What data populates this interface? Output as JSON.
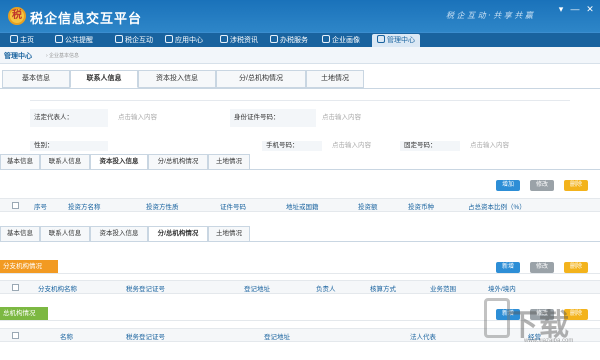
{
  "app": {
    "title": "税企信息交互平台",
    "logo_char": "税",
    "slogan": "税 企 互 动 · 共 享 共 赢",
    "window_controls": [
      "▾",
      "—",
      "✕"
    ]
  },
  "nav": {
    "items": [
      {
        "label": "主页",
        "icon": "home-icon"
      },
      {
        "label": "公共提醒",
        "icon": "bell-icon"
      },
      {
        "label": "税企互动",
        "icon": "chat-icon"
      },
      {
        "label": "应用中心",
        "icon": "apps-icon"
      },
      {
        "label": "涉税资讯",
        "icon": "news-icon"
      },
      {
        "label": "办税服务",
        "icon": "service-icon"
      },
      {
        "label": "企业画像",
        "icon": "portrait-icon"
      },
      {
        "label": "管理中心",
        "icon": "manage-icon"
      }
    ],
    "active_index": 7
  },
  "breadcrumb": {
    "main": "管理中心",
    "sub": "› 企业基本信息"
  },
  "tabs_top": [
    "基本信息",
    "联系人信息",
    "资本投入信息",
    "分/总机构情况",
    "土地情况"
  ],
  "form": {
    "row1": {
      "label_a": "法定代表人：",
      "placeholder_a": "点击输入内容",
      "label_b": "身份证件号码：",
      "placeholder_b": "点击输入内容"
    },
    "row2": {
      "label_a": "性别：",
      "label_b": "手机号码：",
      "placeholder_b": "点击输入内容",
      "label_c": "固定号码：",
      "placeholder_c": "点击输入内容"
    }
  },
  "tabs_capital": [
    "基本信息",
    "联系人信息",
    "资本投入信息",
    "分/总机构情况",
    "土地情况"
  ],
  "capital_buttons": {
    "add": "增加",
    "edit": "修改",
    "delete": "删除"
  },
  "capital_table": {
    "columns": [
      "序号",
      "投资方名称",
      "投资方性质",
      "证件号码",
      "地址或国籍",
      "投资额",
      "投资币种",
      "占总资本比例（%）"
    ]
  },
  "tabs_branch": [
    "基本信息",
    "联系人信息",
    "资本投入信息",
    "分/总机构情况",
    "土地情况"
  ],
  "branch_section": {
    "title": "分支机构情况",
    "buttons": {
      "add": "新增",
      "edit": "修改",
      "delete": "删除"
    },
    "columns": [
      "分支机构名称",
      "税务登记证号",
      "登记地址",
      "负责人",
      "核算方式",
      "业务范围",
      "境外/境内"
    ]
  },
  "head_section": {
    "title": "总机构情况",
    "buttons": {
      "add": "新增",
      "edit": "修改",
      "delete": "删除"
    },
    "columns": [
      "名称",
      "税务登记证号",
      "登记地址",
      "法人代表",
      "经营"
    ]
  },
  "watermark": {
    "text": "下载",
    "sub": "www.xiazaiba.com"
  },
  "colors": {
    "primary": "#1a72ba",
    "nav": "#19639f",
    "orange": "#f29a22",
    "green": "#7cb842",
    "button_blue": "#2d8ed6",
    "button_gray": "#9aa2a8",
    "button_yellow": "#f3b31c"
  }
}
